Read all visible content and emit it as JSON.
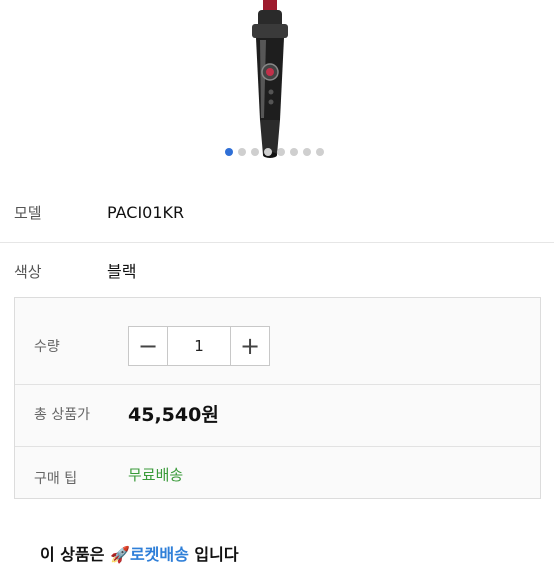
{
  "gallery": {
    "dot_count": 8,
    "active_index": 0
  },
  "specs": {
    "model_label": "모델",
    "model_value": "PACI01KR",
    "color_label": "색상",
    "color_value": "블랙"
  },
  "purchase": {
    "quantity_label": "수량",
    "quantity_value": "1",
    "minus_symbol": "−",
    "plus_symbol": "+",
    "total_label": "총 상품가",
    "total_value": "45,540원",
    "tip_label": "구매 팁",
    "tip_value": "무료배송"
  },
  "footer": {
    "prefix": "이 상품은",
    "rocket_icon": "🚀",
    "rocket_text": "로켓배송",
    "suffix": "입니다"
  },
  "colors": {
    "accent_dot": "#2f6fd6",
    "shipping": "#3a9b3a",
    "rocket": "#2f7fd8"
  }
}
